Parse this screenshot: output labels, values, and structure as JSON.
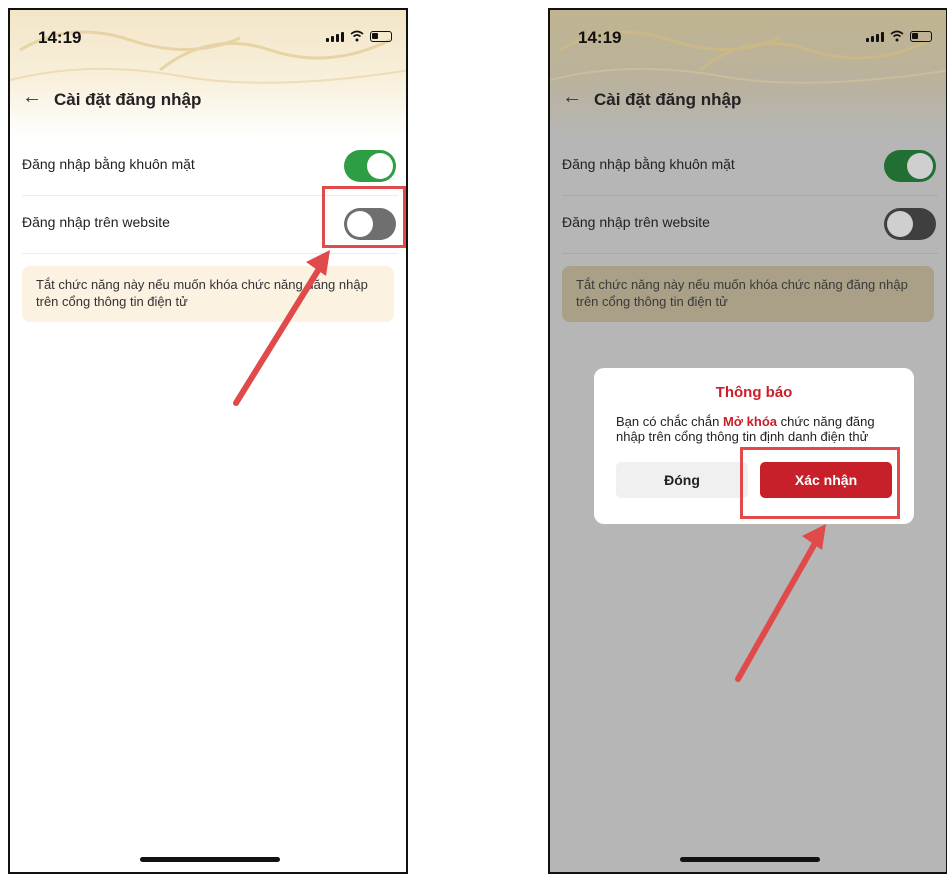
{
  "screens": [
    {
      "status": {
        "time": "14:19"
      },
      "header": {
        "title": "Cài đặt đăng nhập"
      },
      "settings": [
        {
          "label": "Đăng nhập bằng khuôn mặt",
          "enabled": true
        },
        {
          "label": "Đăng nhập trên website",
          "enabled": false
        }
      ],
      "note": "Tắt chức năng này nếu muốn khóa chức năng đăng nhập trên cổng thông tin điện tử"
    },
    {
      "status": {
        "time": "14:19"
      },
      "header": {
        "title": "Cài đặt đăng nhập"
      },
      "settings": [
        {
          "label": "Đăng nhập bằng khuôn mặt",
          "enabled": true
        },
        {
          "label": "Đăng nhập trên website",
          "enabled": false
        }
      ],
      "note": "Tắt chức năng này nếu muốn khóa chức năng đăng nhập trên cổng thông tin điện tử",
      "dialog": {
        "title": "Thông báo",
        "message_prefix": "Bạn có chắc chắn ",
        "message_emphasis": "Mở khóa",
        "message_suffix": " chức năng đăng nhập trên cổng thông tin định danh điện thử",
        "close_label": "Đóng",
        "confirm_label": "Xác nhận"
      }
    }
  ],
  "colors": {
    "toggle_on": "#2e9e44",
    "toggle_off": "#6f6f6f",
    "accent_red": "#c8202a",
    "highlight": "#e04a4a",
    "note_bg": "#fbf2e2"
  }
}
